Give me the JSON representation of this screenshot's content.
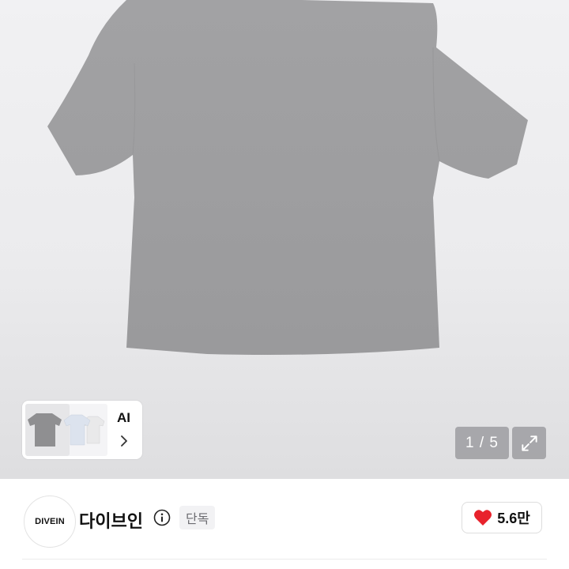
{
  "gallery": {
    "counter": "1 / 5",
    "icons": {
      "expand": "expand-arrows-icon"
    }
  },
  "ai_recommend": {
    "label": "AI",
    "icons": {
      "chevron": "chevron-right-icon"
    }
  },
  "shop": {
    "logo_text": "DIVEIN",
    "name": "다이브인",
    "badge": "단독",
    "icons": {
      "info": "info-circle-icon"
    }
  },
  "likes": {
    "count": "5.6만",
    "heart_color": "#e8222c"
  }
}
